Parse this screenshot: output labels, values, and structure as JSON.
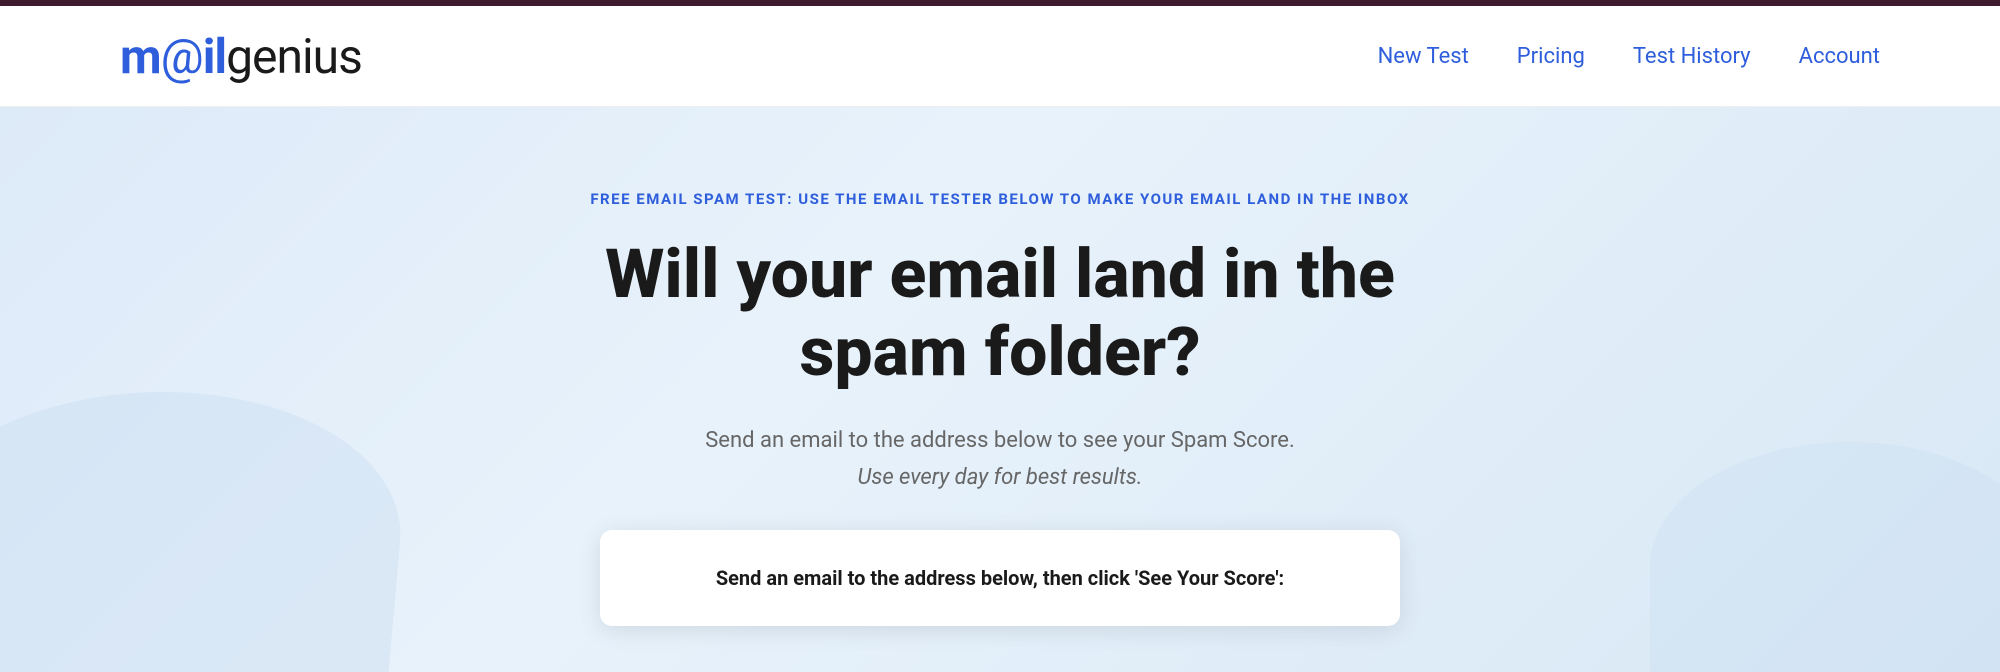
{
  "topbar": {},
  "header": {
    "logo": {
      "m": "m",
      "at": "@",
      "il": "il",
      "genius": "genius"
    },
    "nav": {
      "new_test": "New Test",
      "pricing": "Pricing",
      "test_history": "Test History",
      "account": "Account"
    }
  },
  "hero": {
    "subtitle": "FREE EMAIL SPAM TEST: USE THE EMAIL TESTER BELOW TO MAKE YOUR EMAIL LAND IN THE INBOX",
    "title": "Will your email land in the spam folder?",
    "description": "Send an email to the address below to see your Spam Score.",
    "description_italic": "Use every day for best results.",
    "card_title": "Send an email to the address below, then click 'See Your Score':"
  }
}
